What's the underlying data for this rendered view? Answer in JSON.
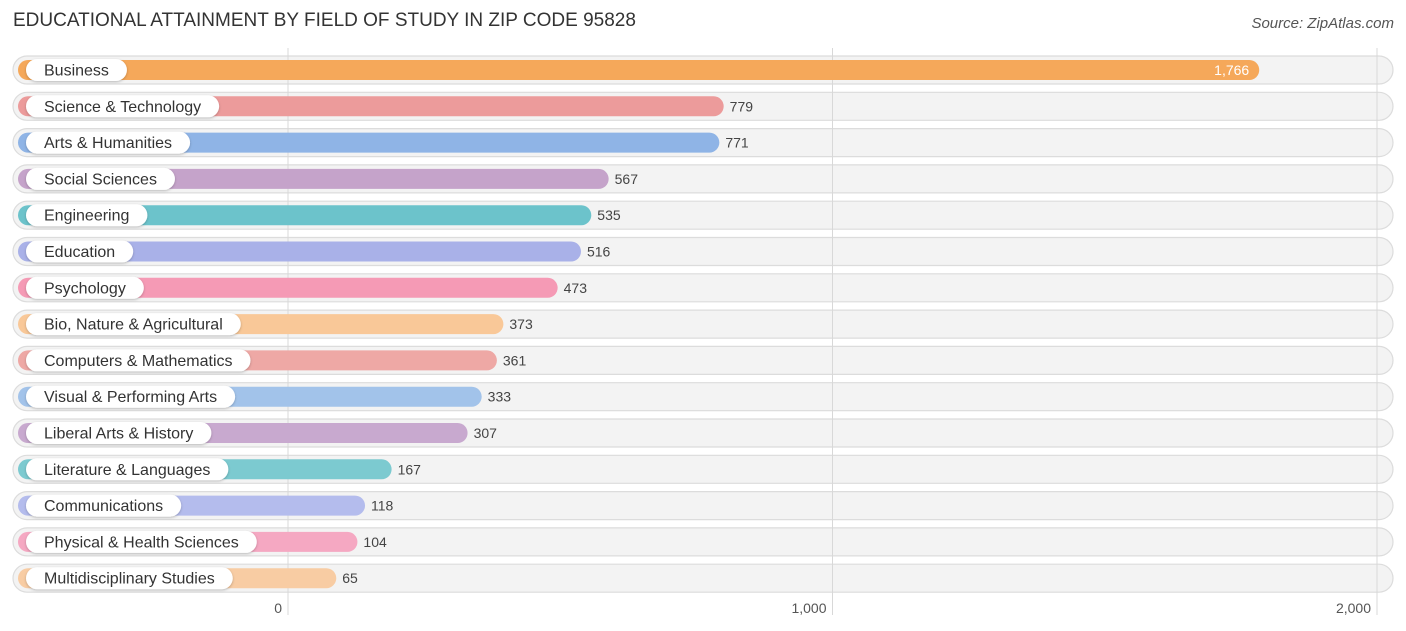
{
  "chart_data": {
    "type": "bar",
    "orientation": "horizontal",
    "title": "EDUCATIONAL ATTAINMENT BY FIELD OF STUDY IN ZIP CODE 95828",
    "source": "Source: ZipAtlas.com",
    "xlabel": "",
    "ylabel": "",
    "xlim": [
      0,
      2000
    ],
    "xticks": [
      0,
      1000,
      2000
    ],
    "xtick_labels": [
      "0",
      "1,000",
      "2,000"
    ],
    "grid": true,
    "categories": [
      "Business",
      "Science & Technology",
      "Arts & Humanities",
      "Social Sciences",
      "Engineering",
      "Education",
      "Psychology",
      "Bio, Nature & Agricultural",
      "Computers & Mathematics",
      "Visual & Performing Arts",
      "Liberal Arts & History",
      "Literature & Languages",
      "Communications",
      "Physical & Health Sciences",
      "Multidisciplinary Studies"
    ],
    "values": [
      1766,
      779,
      771,
      567,
      535,
      516,
      473,
      373,
      361,
      333,
      307,
      167,
      118,
      104,
      65
    ],
    "value_labels": [
      "1,766",
      "779",
      "771",
      "567",
      "535",
      "516",
      "473",
      "373",
      "361",
      "333",
      "307",
      "167",
      "118",
      "104",
      "65"
    ],
    "colors": [
      "#f5a85a",
      "#ec9b9b",
      "#8fb4e6",
      "#c5a3ca",
      "#6cc3cb",
      "#a9b1e8",
      "#f59ab5",
      "#f9c898",
      "#eea8a5",
      "#a2c3ea",
      "#c8a9cf",
      "#7ccad0",
      "#b4bced",
      "#f5a8c2",
      "#f8cca3"
    ]
  }
}
